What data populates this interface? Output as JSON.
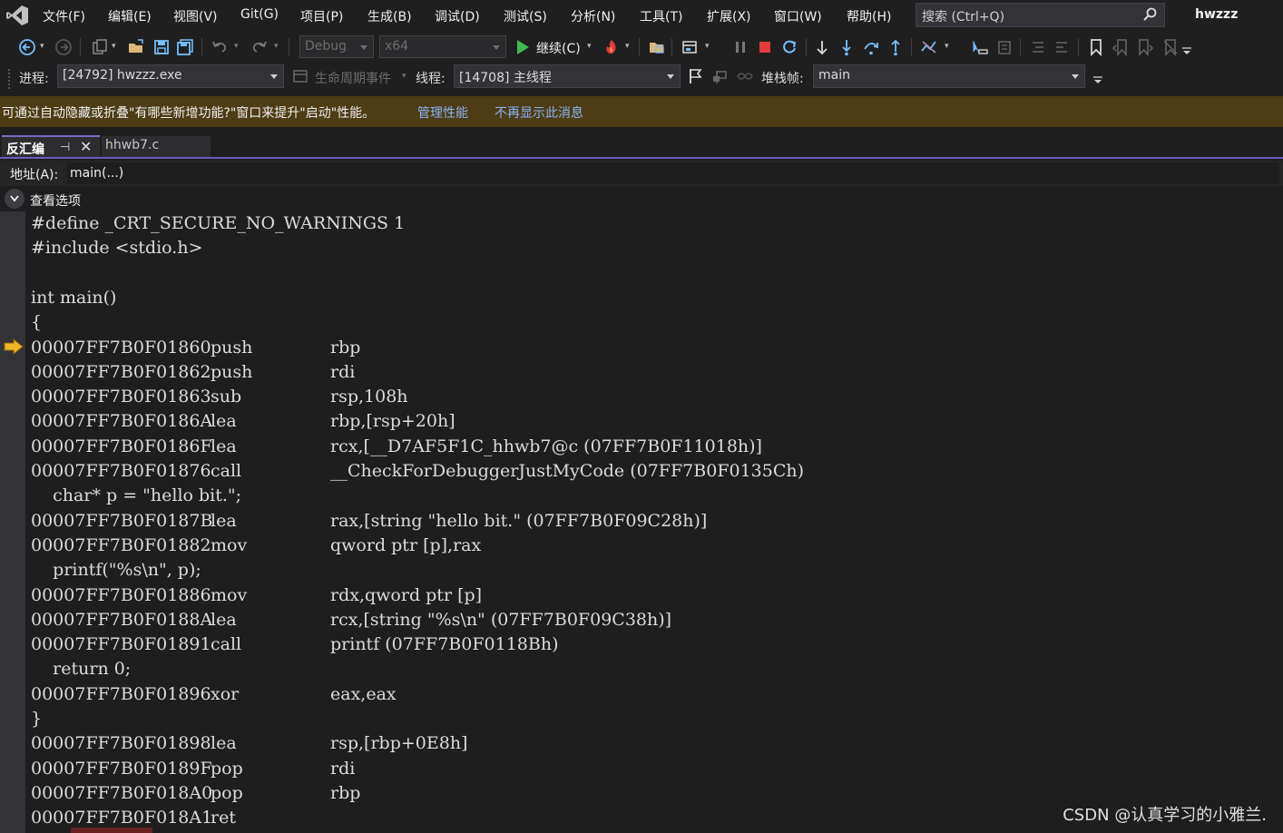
{
  "menu": {
    "items": [
      "文件(F)",
      "编辑(E)",
      "视图(V)",
      "Git(G)",
      "项目(P)",
      "生成(B)",
      "调试(D)",
      "测试(S)",
      "分析(N)",
      "工具(T)",
      "扩展(X)",
      "窗口(W)",
      "帮助(H)"
    ],
    "search_placeholder": "搜索 (Ctrl+Q)",
    "solution_name": "hwzzz"
  },
  "toolbar": {
    "config": "Debug",
    "platform": "x64",
    "continue_label": "继续(C)"
  },
  "debug_location": {
    "process_label": "进程:",
    "process_value": "[24792] hwzzz.exe",
    "lifecycle_label": "生命周期事件",
    "thread_label": "线程:",
    "thread_value": "[14708] 主线程",
    "stackframe_label": "堆栈帧:",
    "stackframe_value": "main"
  },
  "infobar": {
    "message": "可通过自动隐藏或折叠\"有哪些新增功能?\"窗口来提升\"启动\"性能。",
    "link_manage": "管理性能",
    "link_dismiss": "不再显示此消息"
  },
  "tabs": {
    "active": "反汇编",
    "inactive": "hhwb7.c"
  },
  "address": {
    "label": "地址(A):",
    "value": "main(...)"
  },
  "view_options_label": "查看选项",
  "code_lines": [
    {
      "kind": "src",
      "text": "#define _CRT_SECURE_NO_WARNINGS 1"
    },
    {
      "kind": "src",
      "text": "#include <stdio.h>"
    },
    {
      "kind": "src",
      "text": ""
    },
    {
      "kind": "src",
      "text": "int main()"
    },
    {
      "kind": "src",
      "text": "{"
    },
    {
      "kind": "asm",
      "addr": "00007FF7B0F01860",
      "op": "push",
      "arg": "rbp"
    },
    {
      "kind": "asm",
      "addr": "00007FF7B0F01862",
      "op": "push",
      "arg": "rdi"
    },
    {
      "kind": "asm",
      "addr": "00007FF7B0F01863",
      "op": "sub",
      "arg": "rsp,108h"
    },
    {
      "kind": "asm",
      "addr": "00007FF7B0F0186A",
      "op": "lea",
      "arg": "rbp,[rsp+20h]"
    },
    {
      "kind": "asm",
      "addr": "00007FF7B0F0186F",
      "op": "lea",
      "arg": "rcx,[__D7AF5F1C_hhwb7@c (07FF7B0F11018h)]"
    },
    {
      "kind": "asm",
      "addr": "00007FF7B0F01876",
      "op": "call",
      "arg": "__CheckForDebuggerJustMyCode (07FF7B0F0135Ch)"
    },
    {
      "kind": "src",
      "text": "    char* p = \"hello bit.\";"
    },
    {
      "kind": "asm",
      "addr": "00007FF7B0F0187B",
      "op": "lea",
      "arg": "rax,[string \"hello bit.\" (07FF7B0F09C28h)]"
    },
    {
      "kind": "asm",
      "addr": "00007FF7B0F01882",
      "op": "mov",
      "arg": "qword ptr [p],rax"
    },
    {
      "kind": "src",
      "text": "    printf(\"%s\\n\", p);"
    },
    {
      "kind": "asm",
      "addr": "00007FF7B0F01886",
      "op": "mov",
      "arg": "rdx,qword ptr [p]"
    },
    {
      "kind": "asm",
      "addr": "00007FF7B0F0188A",
      "op": "lea",
      "arg": "rcx,[string \"%s\\n\" (07FF7B0F09C38h)]"
    },
    {
      "kind": "asm",
      "addr": "00007FF7B0F01891",
      "op": "call",
      "arg": "printf (07FF7B0F0118Bh)"
    },
    {
      "kind": "src",
      "text": "    return 0;"
    },
    {
      "kind": "asm",
      "addr": "00007FF7B0F01896",
      "op": "xor",
      "arg": "eax,eax"
    },
    {
      "kind": "src",
      "text": "}"
    },
    {
      "kind": "asm",
      "addr": "00007FF7B0F01898",
      "op": "lea",
      "arg": "rsp,[rbp+0E8h]"
    },
    {
      "kind": "asm",
      "addr": "00007FF7B0F0189F",
      "op": "pop",
      "arg": "rdi"
    },
    {
      "kind": "asm",
      "addr": "00007FF7B0F018A0",
      "op": "pop",
      "arg": "rbp"
    },
    {
      "kind": "asm",
      "addr": "00007FF7B0F018A1",
      "op": "ret",
      "arg": ""
    }
  ],
  "watermark": "CSDN @认真学习的小雅兰.",
  "colors": {
    "accent": "#7b68c8",
    "infobar_bg": "#4d3c14",
    "link": "#8ab4f8",
    "exec_arrow": "#f0b429",
    "stop": "#e03c3c",
    "play": "#3fb950"
  }
}
